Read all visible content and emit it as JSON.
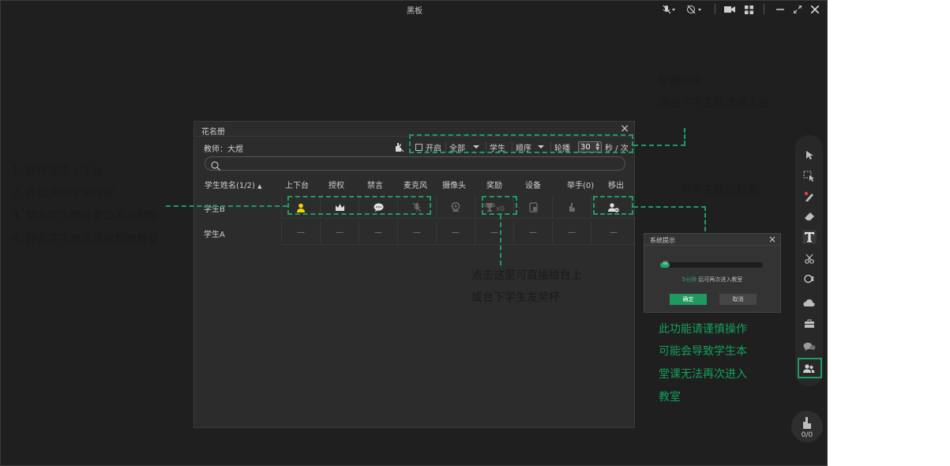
{
  "window": {
    "title": "黑板"
  },
  "roster": {
    "title": "花名册",
    "close": "×",
    "teacher": "教师：大煜",
    "rotate": {
      "enable_label": "开启",
      "scope": "全部",
      "target": "学生",
      "order": "顺序",
      "interval_label": "轮播",
      "interval_value": "30",
      "unit": "秒 / 次"
    },
    "columns": [
      "学生姓名(1/2)",
      "上下台",
      "授权",
      "禁言",
      "麦克风",
      "摄像头",
      "奖励",
      "设备",
      "举手(0)",
      "移出"
    ],
    "rows": [
      {
        "name": "学生B",
        "reward_count": "x0"
      },
      {
        "name": "学生A",
        "cells": [
          "—",
          "—",
          "—",
          "—",
          "—",
          "—",
          "—",
          "—",
          "—"
        ]
      }
    ]
  },
  "hand_count": "0/0",
  "dialog": {
    "title": "系统提示",
    "close": "×",
    "progress_text": "III",
    "progress": 0.09,
    "time": "5分钟",
    "message": "后可再次进入教室",
    "ok": "确定",
    "cancel": "取消"
  },
  "annotations": {
    "left": [
      "1. 操作学生上下台",
      "2. 开启关闭学生授权",
      "3. 禁言学生聊天窗口发言权限",
      "4. 静音学生麦克风或解除静音"
    ],
    "rotate": [
      "轮播功能：",
      "将台下学生轮流请上台"
    ],
    "remove": "将学生移出教室",
    "reward": [
      "点击这里可直接给台上",
      "或台下学生发奖杯"
    ],
    "warning": [
      "此功能请谨慎操作",
      "可能会导致学生本",
      "堂课无法再次进入",
      "教室"
    ]
  },
  "colors": {
    "accent": "#1f9a63",
    "warning_text": "#13a05a",
    "active_user": "#f5d400"
  }
}
